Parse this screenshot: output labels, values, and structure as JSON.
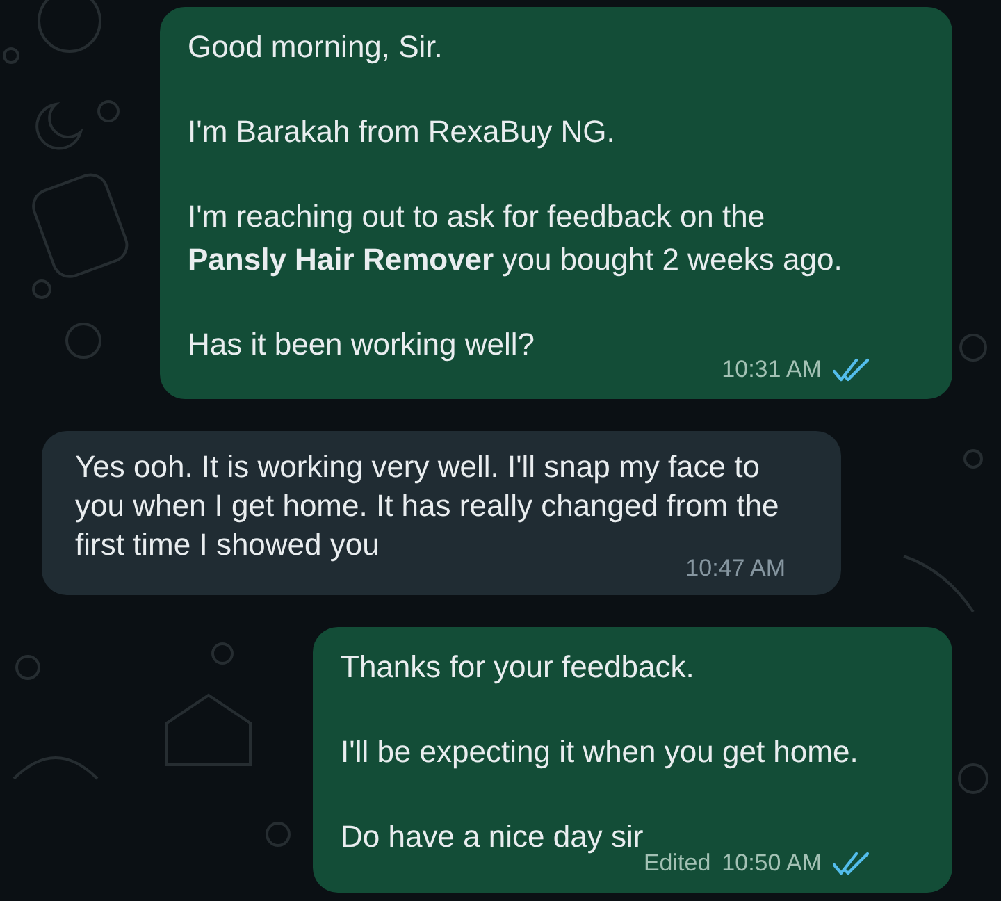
{
  "messages": [
    {
      "kind": "outgoing",
      "paragraphs": [
        "Good morning, Sir.",
        "I'm Barakah from RexaBuy NG.",
        "I'm reaching out to ask for feedback on the **Pansly Hair Remover** you bought 2 weeks ago.",
        "Has it been working well?"
      ],
      "time": "10:31 AM",
      "read": true
    },
    {
      "kind": "incoming",
      "paragraphs": [
        "Yes ooh. It is working very well. I'll snap my face to you when I get home. It has really changed from the first time I showed you"
      ],
      "time": "10:47 AM"
    },
    {
      "kind": "outgoing",
      "paragraphs": [
        "Thanks for your feedback.",
        "I'll be expecting it when you get home.",
        "Do have a nice day sir"
      ],
      "edited_label": "Edited",
      "time": "10:50 AM",
      "read": true
    }
  ]
}
